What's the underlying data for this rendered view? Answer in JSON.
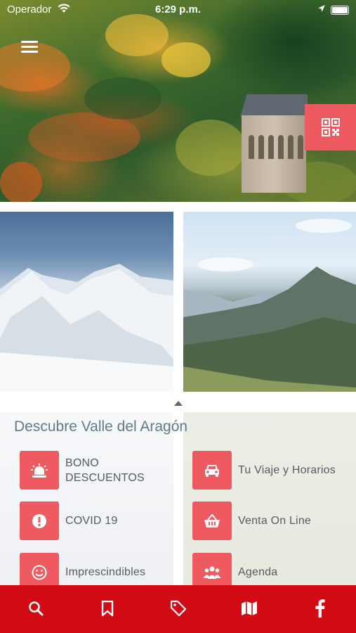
{
  "status_bar": {
    "carrier": "Operador",
    "time": "6:29 p.m."
  },
  "discover": {
    "title": "Descubre Valle del Aragón",
    "items": [
      {
        "label": "BONO DESCUENTOS",
        "icon": "siren-icon"
      },
      {
        "label": "Tu Viaje y Horarios",
        "icon": "car-icon"
      },
      {
        "label": "COVID 19",
        "icon": "alert-icon"
      },
      {
        "label": "Venta On Line",
        "icon": "basket-icon"
      },
      {
        "label": "Imprescindibles",
        "icon": "smiley-icon"
      },
      {
        "label": "Agenda",
        "icon": "people-icon"
      }
    ]
  },
  "tab_bar": {
    "tabs": [
      "search-icon",
      "bookmark-icon",
      "tag-icon",
      "map-icon",
      "facebook-icon"
    ]
  },
  "colors": {
    "accent": "#ef5a60",
    "tab_bar": "#d10a14",
    "title": "#5e7c8a"
  }
}
